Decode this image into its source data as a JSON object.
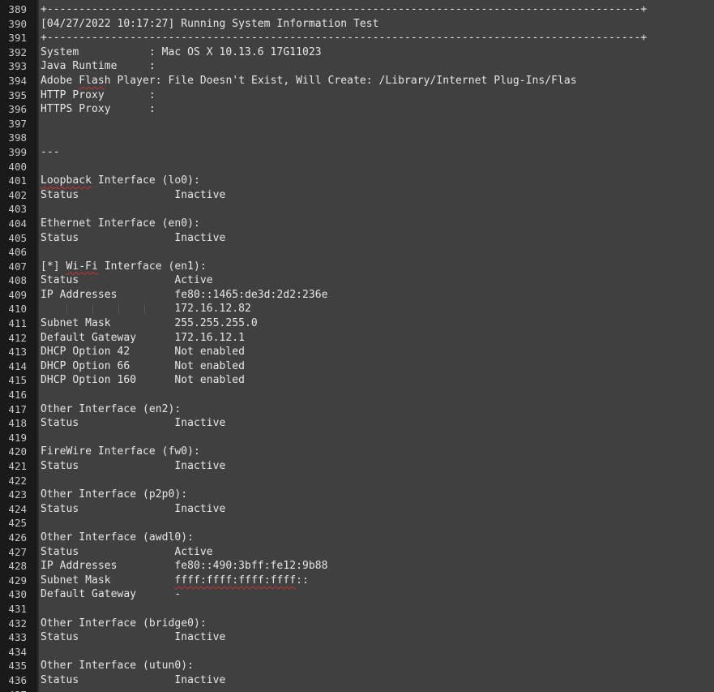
{
  "editor": {
    "lines": [
      {
        "n": "389",
        "t": "+---------------------------------------------------------------------------------------------+"
      },
      {
        "n": "390",
        "t": "[04/27/2022 10:17:27] Running System Information Test"
      },
      {
        "n": "391",
        "t": "+---------------------------------------------------------------------------------------------+"
      },
      {
        "n": "392",
        "t": "System           : Mac OS X 10.13.6 17G11023"
      },
      {
        "n": "393",
        "t": "Java Runtime     :"
      },
      {
        "n": "394",
        "t": "Adobe Flash Player: File Doesn't Exist, Will Create: /Library/Internet Plug-Ins/Flas"
      },
      {
        "n": "395",
        "t": "HTTP Proxy       :"
      },
      {
        "n": "396",
        "t": "HTTPS Proxy      :"
      },
      {
        "n": "397",
        "t": ""
      },
      {
        "n": "398",
        "t": ""
      },
      {
        "n": "399",
        "t": "---"
      },
      {
        "n": "400",
        "t": ""
      },
      {
        "n": "401",
        "t": "Loopback Interface (lo0):"
      },
      {
        "n": "402",
        "t": "Status               Inactive"
      },
      {
        "n": "403",
        "t": ""
      },
      {
        "n": "404",
        "t": "Ethernet Interface (en0):"
      },
      {
        "n": "405",
        "t": "Status               Inactive"
      },
      {
        "n": "406",
        "t": ""
      },
      {
        "n": "407",
        "t": "[*] Wi-Fi Interface (en1):"
      },
      {
        "n": "408",
        "t": "Status               Active"
      },
      {
        "n": "409",
        "t": "IP Addresses         fe80::1465:de3d:2d2:236e"
      },
      {
        "n": "410",
        "t": "                     172.16.12.82"
      },
      {
        "n": "411",
        "t": "Subnet Mask          255.255.255.0"
      },
      {
        "n": "412",
        "t": "Default Gateway      172.16.12.1"
      },
      {
        "n": "413",
        "t": "DHCP Option 42       Not enabled"
      },
      {
        "n": "414",
        "t": "DHCP Option 66       Not enabled"
      },
      {
        "n": "415",
        "t": "DHCP Option 160      Not enabled"
      },
      {
        "n": "416",
        "t": ""
      },
      {
        "n": "417",
        "t": "Other Interface (en2):"
      },
      {
        "n": "418",
        "t": "Status               Inactive"
      },
      {
        "n": "419",
        "t": ""
      },
      {
        "n": "420",
        "t": "FireWire Interface (fw0):"
      },
      {
        "n": "421",
        "t": "Status               Inactive"
      },
      {
        "n": "422",
        "t": ""
      },
      {
        "n": "423",
        "t": "Other Interface (p2p0):"
      },
      {
        "n": "424",
        "t": "Status               Inactive"
      },
      {
        "n": "425",
        "t": ""
      },
      {
        "n": "426",
        "t": "Other Interface (awdl0):"
      },
      {
        "n": "427",
        "t": "Status               Active"
      },
      {
        "n": "428",
        "t": "IP Addresses         fe80::490:3bff:fe12:9b88"
      },
      {
        "n": "429",
        "t": "Subnet Mask          ffff:ffff:ffff:ffff::"
      },
      {
        "n": "430",
        "t": "Default Gateway      -"
      },
      {
        "n": "431",
        "t": ""
      },
      {
        "n": "432",
        "t": "Other Interface (bridge0):"
      },
      {
        "n": "433",
        "t": "Status               Inactive"
      },
      {
        "n": "434",
        "t": ""
      },
      {
        "n": "435",
        "t": "Other Interface (utun0):"
      },
      {
        "n": "436",
        "t": "Status               Inactive"
      },
      {
        "n": "437",
        "t": ""
      }
    ]
  },
  "colors": {
    "background": "#404040",
    "gutter": "#1a1a1a",
    "text": "#e6e6e6",
    "line_number": "#c8c8c8",
    "spell_underline": "#d03030"
  }
}
